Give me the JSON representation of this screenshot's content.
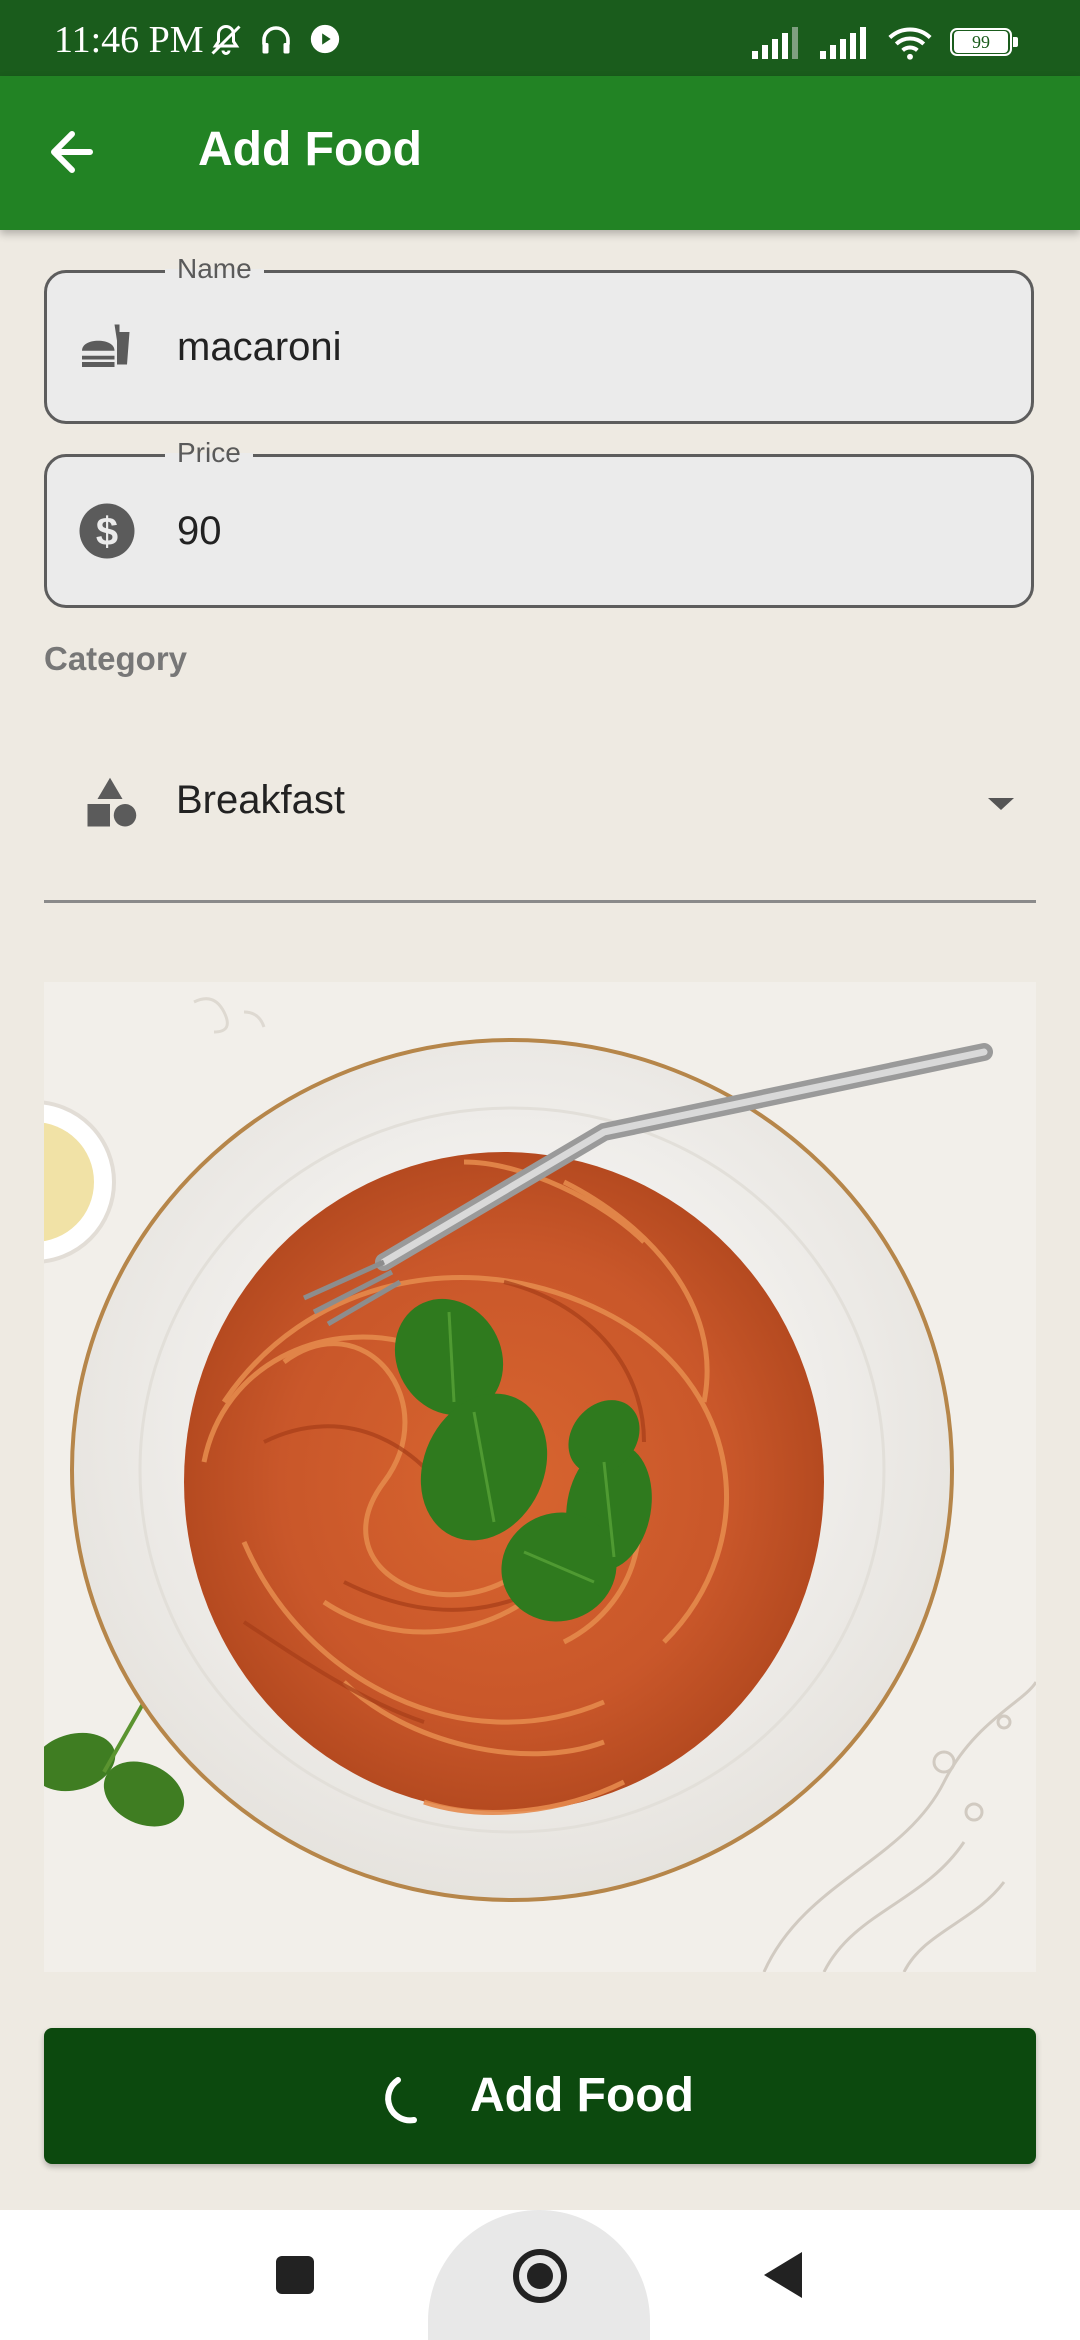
{
  "status_bar": {
    "time": "11:46 PM",
    "battery": "99",
    "icons": [
      "mute-icon",
      "headset-icon",
      "play-icon",
      "signal-icon",
      "signal-icon",
      "wifi-icon",
      "battery-icon"
    ]
  },
  "app_bar": {
    "title": "Add Food",
    "back_icon": "arrow-left-icon"
  },
  "form": {
    "name": {
      "label": "Name",
      "value": "macaroni",
      "icon": "fastfood-icon"
    },
    "price": {
      "label": "Price",
      "value": "90",
      "icon": "dollar-icon"
    },
    "category": {
      "label": "Category",
      "value": "Breakfast",
      "icon": "category-shapes-icon"
    }
  },
  "image": {
    "subject": "food-photo"
  },
  "submit": {
    "label": "Add Food"
  },
  "nav_bar": {
    "buttons": [
      "recents",
      "home",
      "back"
    ]
  },
  "colors": {
    "status_bar": "#1A5C1C",
    "app_bar": "#228324",
    "button": "#0C490E",
    "background": "#EEEAE2"
  }
}
